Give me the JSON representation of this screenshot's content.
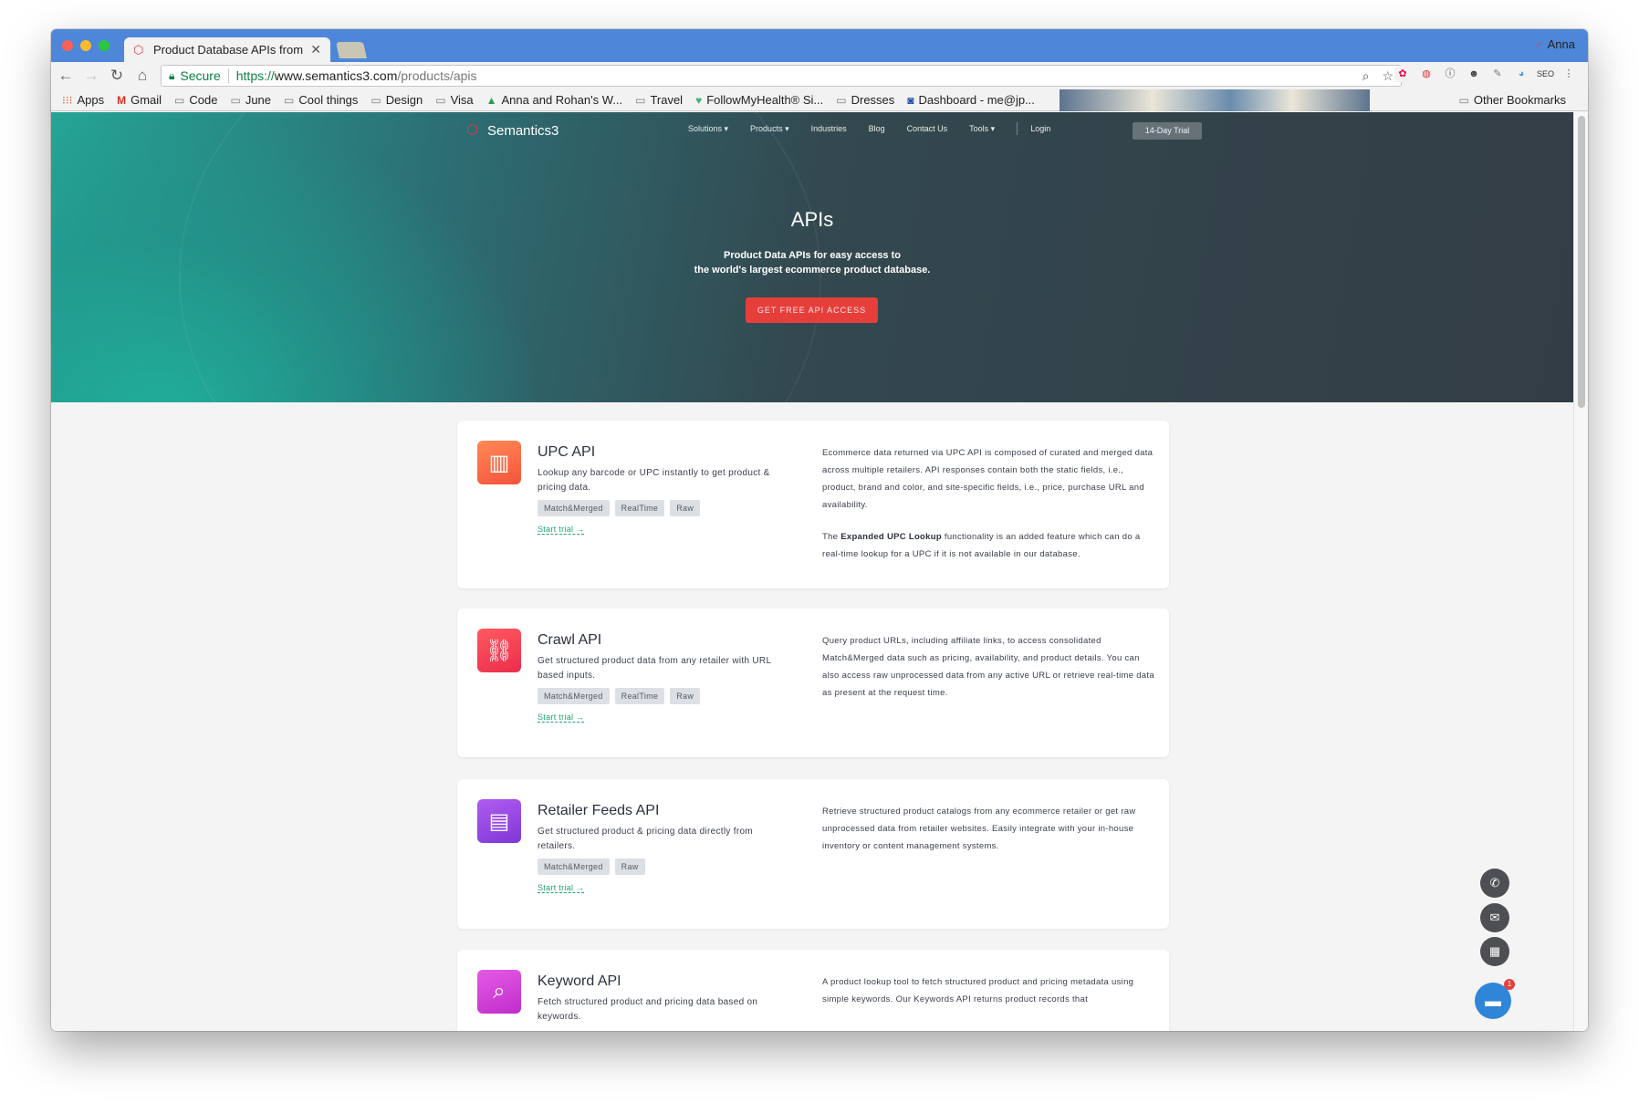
{
  "browser": {
    "tab_title": "Product Database APIs from th",
    "profile_name": "Anna",
    "secure_label": "Secure",
    "url_proto": "https://",
    "url_host": "www.semantics3.com",
    "url_path": "/products/apis",
    "bookmarks": [
      "Apps",
      "Gmail",
      "Code",
      "June",
      "Cool things",
      "Design",
      "Visa",
      "Anna and Rohan's W...",
      "Travel",
      "FollowMyHealth® Si...",
      "Dresses",
      "Dashboard - me@jp..."
    ],
    "other_bookmarks": "Other Bookmarks"
  },
  "site": {
    "brand": "Semantics3",
    "nav": [
      "Solutions ▾",
      "Products ▾",
      "Industries",
      "Blog",
      "Contact Us",
      "Tools ▾"
    ],
    "login": "Login",
    "trial": "14-Day Trial"
  },
  "hero": {
    "title": "APIs",
    "sub_line1": "Product Data APIs for easy access to",
    "sub_line2": "the world's largest ecommerce product database.",
    "cta": "GET FREE API ACCESS"
  },
  "cards": [
    {
      "title": "UPC API",
      "desc": "Lookup any barcode or UPC instantly to get product & pricing data.",
      "tags": [
        "Match&Merged",
        "RealTime",
        "Raw"
      ],
      "start": "Start trial →",
      "right_p1": "Ecommerce data returned via UPC API is composed of curated and merged data across multiple retailers. API responses contain both the static fields, i.e., product, brand and color, and site-specific fields, i.e., price, purchase URL and availability.",
      "right_p2_pre": "The ",
      "right_p2_bold": "Expanded UPC Lookup",
      "right_p2_post": " functionality is an added feature which can do a real-time lookup for a UPC if it is not available in our database.",
      "color": "#fc6a4b"
    },
    {
      "title": "Crawl API",
      "desc": "Get structured product data from any retailer with URL based inputs.",
      "tags": [
        "Match&Merged",
        "RealTime",
        "Raw"
      ],
      "start": "Start trial →",
      "right_p1": "Query product URLs, including affiliate links, to access consolidated Match&Merged data such as pricing, availability, and product details. You can also access raw unprocessed data from any active URL or retrieve real-time data as present at the request time.",
      "color": "#f43f52"
    },
    {
      "title": "Retailer Feeds API",
      "desc": "Get structured product & pricing data directly from retailers.",
      "tags": [
        "Match&Merged",
        "Raw"
      ],
      "start": "Start trial →",
      "right_p1": "Retrieve structured product catalogs from any ecommerce retailer or get raw unprocessed data from retailer websites. Easily integrate with your in-house inventory or content management systems.",
      "color": "#9b44e0"
    },
    {
      "title": "Keyword API",
      "desc": "Fetch structured product and pricing data based on keywords.",
      "right_p1": "A product lookup tool to fetch structured product and pricing metadata using simple keywords. Our Keywords API returns product records that",
      "color": "#d63fd3"
    }
  ],
  "chat_badge": "1"
}
